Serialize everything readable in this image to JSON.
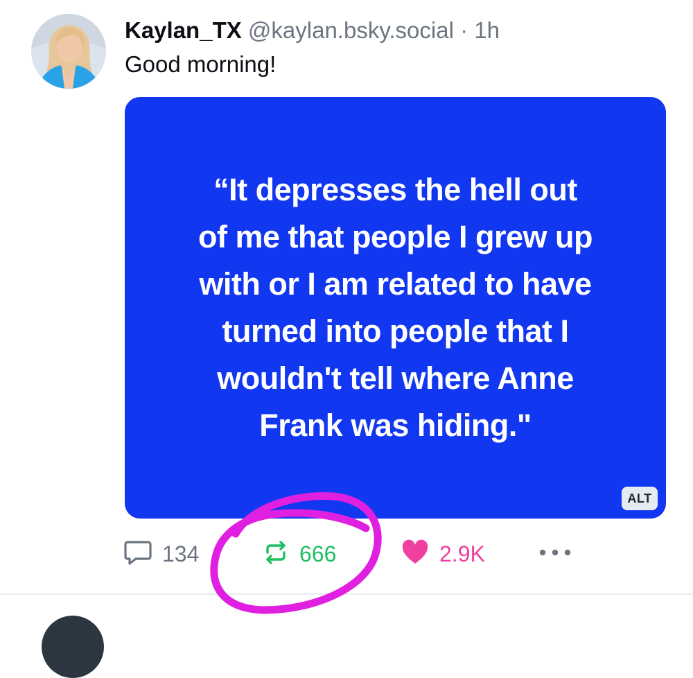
{
  "post": {
    "author": {
      "display_name": "Kaylan_TX",
      "handle": "@kaylan.bsky.social",
      "separator": "·",
      "time": "1h"
    },
    "text": "Good morning!",
    "image": {
      "background_color": "#1237f0",
      "quote_lines": [
        "“It depresses the hell out",
        "of me that people I grew up",
        "with or I am related to have",
        "turned into people that I",
        "wouldn't tell where Anne",
        "Frank was hiding.\""
      ],
      "alt_label": "ALT"
    },
    "actions": {
      "reply": {
        "icon": "speech-bubble-icon",
        "count": "134",
        "color": "#6b7480"
      },
      "repost": {
        "icon": "repost-arrows-icon",
        "count": "666",
        "color": "#1fbf63"
      },
      "like": {
        "icon": "heart-icon",
        "count": "2.9K",
        "color": "#ef3fa0"
      },
      "more": {
        "icon": "ellipsis-icon"
      }
    }
  },
  "annotation": {
    "type": "hand-drawn-circle",
    "color": "#e020e0",
    "target": "repost-count"
  }
}
